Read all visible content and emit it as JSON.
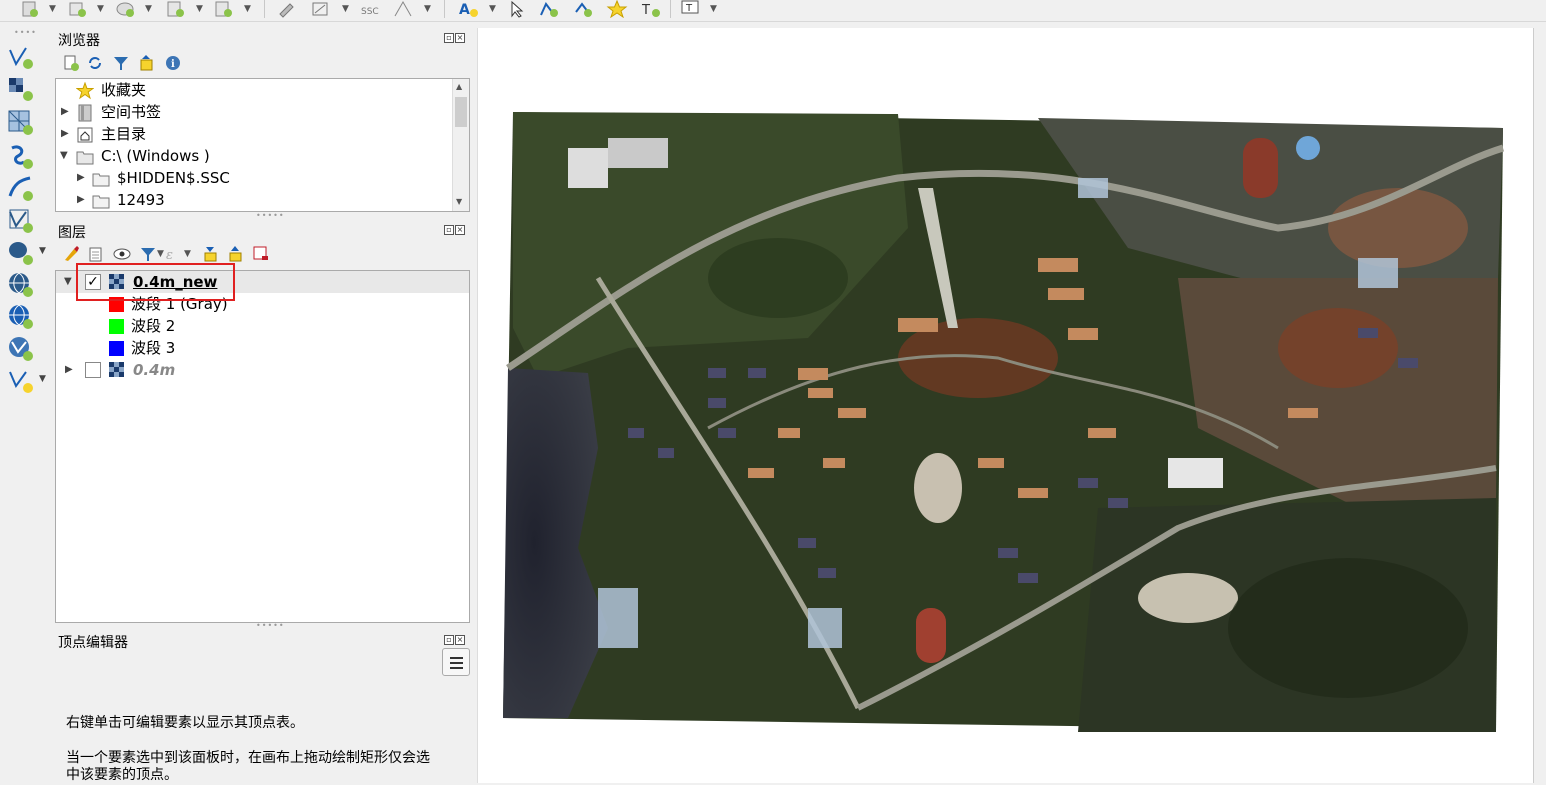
{
  "browser_panel": {
    "title": "浏览器",
    "items": [
      {
        "label": "收藏夹",
        "icon": "star-icon"
      },
      {
        "label": "空间书签",
        "icon": "bookmark-icon"
      },
      {
        "label": "主目录",
        "icon": "home-folder-icon"
      },
      {
        "label": "C:\\ (Windows )",
        "icon": "drive-folder-icon"
      },
      {
        "label": "$HIDDEN$.SSC",
        "icon": "folder-icon"
      },
      {
        "label": "12493",
        "icon": "folder-icon"
      }
    ]
  },
  "layers_panel": {
    "title": "图层",
    "layers": [
      {
        "name": "0.4m_new",
        "checked": true,
        "bands": [
          "波段 1 (Gray)",
          "波段 2",
          "波段 3"
        ]
      },
      {
        "name": "0.4m",
        "checked": false
      }
    ]
  },
  "vertex_editor": {
    "title": "顶点编辑器",
    "line1": "右键单击可编辑要素以显示其顶点表。",
    "line2": "当一个要素选中到该面板时，在画布上拖动绘制矩形仅会选",
    "line3": "中该要素的顶点。"
  },
  "colors": {
    "band1": "#ff0000",
    "band2": "#00ff00",
    "band3": "#0000ff",
    "highlight": "#e02020"
  }
}
